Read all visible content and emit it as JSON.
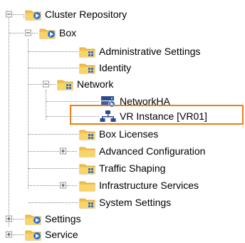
{
  "tree": {
    "root": {
      "label": "Cluster Repository",
      "icon": "folder-gear-icon"
    },
    "box": {
      "label": "Box",
      "icon": "folder-gear-icon"
    },
    "admin": {
      "label": "Administrative Settings",
      "icon": "folder-settings-icon"
    },
    "identity": {
      "label": "Identity",
      "icon": "folder-settings-icon"
    },
    "network": {
      "label": "Network",
      "icon": "folder-settings-icon"
    },
    "networkha": {
      "label": "NetworkHA",
      "icon": "server-gear-icon"
    },
    "vr": {
      "label": "VR Instance [VR01]",
      "icon": "network-instance-icon"
    },
    "licenses": {
      "label": "Box Licenses",
      "icon": "folder-settings-icon"
    },
    "advanced": {
      "label": "Advanced Configuration",
      "icon": "folder-icon"
    },
    "traffic": {
      "label": "Traffic Shaping",
      "icon": "folder-settings-icon"
    },
    "infra": {
      "label": "Infrastructure Services",
      "icon": "folder-icon"
    },
    "system": {
      "label": "System Settings",
      "icon": "folder-settings-icon"
    },
    "settings": {
      "label": "Settings",
      "icon": "folder-gear-icon"
    },
    "service": {
      "label": "Service",
      "icon": "folder-gear-icon"
    }
  },
  "colors": {
    "selection_border": "#ee7d1a",
    "folder": "#f4c24c",
    "gear": "#2c6fd1"
  }
}
